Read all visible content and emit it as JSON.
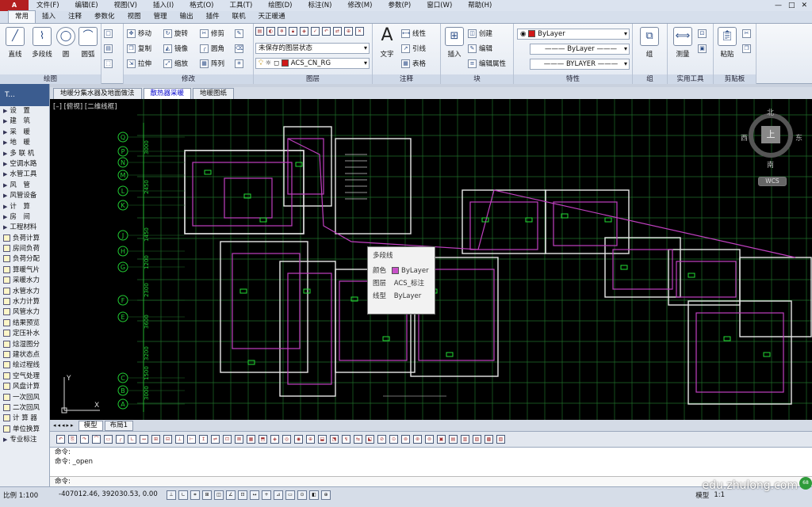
{
  "menubar": {
    "items": [
      "文件(F)",
      "编辑(E)",
      "视图(V)",
      "插入(I)",
      "格式(O)",
      "工具(T)",
      "绘图(D)",
      "标注(N)",
      "修改(M)",
      "参数(P)",
      "窗口(W)",
      "帮助(H)"
    ],
    "win_ctrls": [
      "—",
      "□",
      "✕"
    ]
  },
  "ribbon_tabs": [
    "常用",
    "插入",
    "注释",
    "参数化",
    "视图",
    "管理",
    "输出",
    "插件",
    "联机",
    "天正暖通"
  ],
  "ribbon": {
    "draw": {
      "title": "绘图",
      "tools": [
        "直线",
        "多段线",
        "圆",
        "圆弧"
      ]
    },
    "modify": {
      "title": "修改",
      "tools": [
        "移动",
        "旋转",
        "修剪",
        "复制",
        "镜像",
        "圆角",
        "拉伸",
        "缩放",
        "阵列"
      ]
    },
    "layers": {
      "title": "图层",
      "state": "未保存的图层状态",
      "current": "ACS_CN_RG",
      "current_color": "#d01818"
    },
    "annotation": {
      "title": "注释",
      "big": "文字",
      "tools": [
        "线性",
        "引线",
        "表格"
      ]
    },
    "block": {
      "title": "块",
      "big": "插入",
      "tools": [
        "创建",
        "编辑",
        "编辑属性"
      ]
    },
    "properties": {
      "title": "特性",
      "color": "ByLayer",
      "linetype": "ByLayer",
      "lineweight": "BYLAYER"
    },
    "groups": {
      "title": "组",
      "big": "组"
    },
    "utilities": {
      "title": "实用工具",
      "big": "测量"
    },
    "clipboard": {
      "title": "剪贴板",
      "big": "粘贴"
    }
  },
  "tool_palette": {
    "title": "T...",
    "items": [
      {
        "label": "设　置",
        "arrow": true
      },
      {
        "label": "建　筑",
        "arrow": true
      },
      {
        "label": "采　暖",
        "arrow": true
      },
      {
        "label": "地　暖",
        "arrow": true
      },
      {
        "label": "多 联 机",
        "arrow": true
      },
      {
        "label": "空调水路",
        "arrow": true
      },
      {
        "label": "水管工具",
        "arrow": true
      },
      {
        "label": "风　管",
        "arrow": true
      },
      {
        "label": "风管设备",
        "arrow": true
      },
      {
        "label": "计　算",
        "arrow": true
      },
      {
        "label": "房　间",
        "arrow": true
      },
      {
        "label": "工程材料",
        "arrow": true
      },
      {
        "label": "负荷计算",
        "icon": true
      },
      {
        "label": "房间负荷",
        "icon": true
      },
      {
        "label": "负荷分配",
        "icon": true
      },
      {
        "label": "算暖气片",
        "icon": true
      },
      {
        "label": "采暖水力",
        "icon": true
      },
      {
        "label": "水管水力",
        "icon": true
      },
      {
        "label": "水力计算",
        "icon": true
      },
      {
        "label": "风管水力",
        "icon": true
      },
      {
        "label": "结果预览",
        "icon": true
      },
      {
        "label": "定压补水",
        "icon": true
      },
      {
        "label": "焓湿图分",
        "icon": true
      },
      {
        "label": "建状态点",
        "icon": true
      },
      {
        "label": "绘过程线",
        "icon": true
      },
      {
        "label": "空气处理",
        "icon": true
      },
      {
        "label": "风盘计算",
        "icon": true
      },
      {
        "label": "一次回风",
        "icon": true
      },
      {
        "label": "二次回风",
        "icon": true
      },
      {
        "label": "计 算 器",
        "icon": true
      },
      {
        "label": "单位换算",
        "icon": true
      },
      {
        "label": "专业标注",
        "arrow": true
      }
    ]
  },
  "doc_tabs": [
    "地暖分集水器及地面做法",
    "散热器采暖",
    "地暖图纸"
  ],
  "active_doc_tab": 1,
  "viewport_label": "[–] [俯视] [二维线框]",
  "viewcube": {
    "n": "北",
    "s": "南",
    "w": "西",
    "e": "东",
    "face": "上",
    "wcs": "WCS"
  },
  "tooltip": {
    "title": "多段线",
    "rows": [
      {
        "k": "颜色",
        "v": "ByLayer",
        "swatch": "#c850c8"
      },
      {
        "k": "图层",
        "v": "ACS_标注"
      },
      {
        "k": "线型",
        "v": "ByLayer"
      }
    ]
  },
  "grid_axes_left": [
    "Q",
    "P",
    "N",
    "M",
    "L",
    "K",
    "J",
    "H",
    "G",
    "F",
    "E",
    "C",
    "B",
    "A"
  ],
  "dims_left": [
    "3000",
    "2450",
    "1450",
    "1200",
    "2300",
    "3600",
    "3200",
    "1500",
    "3000"
  ],
  "layout_tabs": [
    "模型",
    "布局1"
  ],
  "command": {
    "lines": [
      "命令:",
      "命令: _open"
    ],
    "prompt": "命令:"
  },
  "status": {
    "scale": "比例 1:100",
    "coords": "-407012.46, 392030.53, 0.00",
    "model": "模型",
    "annoscale": "1:1"
  },
  "watermark": "edu.zhulong.com",
  "badge": "68"
}
